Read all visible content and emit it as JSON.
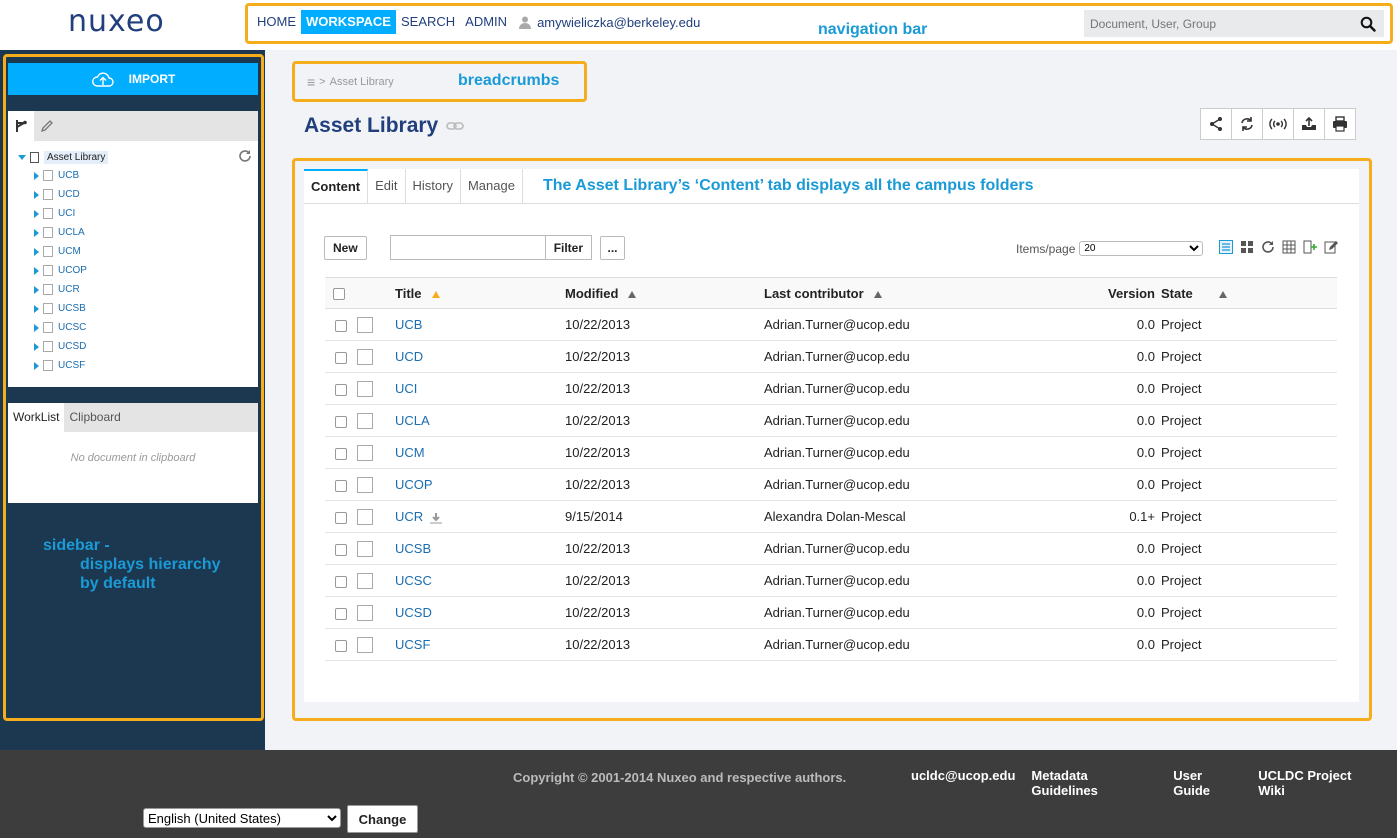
{
  "header": {
    "logo": "nuxeo",
    "nav": [
      "HOME",
      "WORKSPACE",
      "SEARCH",
      "ADMIN"
    ],
    "active_nav": "WORKSPACE",
    "user": "amywieliczka@berkeley.edu",
    "search_placeholder": "Document, User, Group"
  },
  "annotations": {
    "navigation_bar": "navigation bar",
    "breadcrumbs": "breadcrumbs",
    "content_tab": "The Asset Library’s ‘Content’ tab displays all the campus folders",
    "sidebar_1": "sidebar -",
    "sidebar_2": "displays hierarchy",
    "sidebar_3": "by default"
  },
  "sidebar": {
    "import_label": "IMPORT",
    "tree_root": "Asset Library",
    "tree_items": [
      "UCB",
      "UCD",
      "UCI",
      "UCLA",
      "UCM",
      "UCOP",
      "UCR",
      "UCSB",
      "UCSC",
      "UCSD",
      "UCSF"
    ],
    "clip_tabs": [
      "WorkList",
      "Clipboard"
    ],
    "clip_empty": "No document in clipboard"
  },
  "main": {
    "breadcrumb_icon": "≡",
    "breadcrumb_sep": ">",
    "breadcrumb": "Asset Library",
    "title": "Asset Library",
    "tabs": [
      "Content",
      "Edit",
      "History",
      "Manage"
    ],
    "new_label": "New",
    "filter_label": "Filter",
    "more_label": "...",
    "items_per_page_label": "Items/page",
    "items_per_page_value": "20",
    "columns": {
      "title": "Title",
      "modified": "Modified",
      "contributor": "Last contributor",
      "version": "Version",
      "state": "State"
    },
    "rows": [
      {
        "title": "UCB",
        "modified": "10/22/2013",
        "contributor": "Adrian.Turner@ucop.edu",
        "version": "0.0",
        "state": "Project"
      },
      {
        "title": "UCD",
        "modified": "10/22/2013",
        "contributor": "Adrian.Turner@ucop.edu",
        "version": "0.0",
        "state": "Project"
      },
      {
        "title": "UCI",
        "modified": "10/22/2013",
        "contributor": "Adrian.Turner@ucop.edu",
        "version": "0.0",
        "state": "Project"
      },
      {
        "title": "UCLA",
        "modified": "10/22/2013",
        "contributor": "Adrian.Turner@ucop.edu",
        "version": "0.0",
        "state": "Project"
      },
      {
        "title": "UCM",
        "modified": "10/22/2013",
        "contributor": "Adrian.Turner@ucop.edu",
        "version": "0.0",
        "state": "Project"
      },
      {
        "title": "UCOP",
        "modified": "10/22/2013",
        "contributor": "Adrian.Turner@ucop.edu",
        "version": "0.0",
        "state": "Project"
      },
      {
        "title": "UCR",
        "modified": "9/15/2014",
        "contributor": "Alexandra Dolan-Mescal",
        "version": "0.1+",
        "state": "Project"
      },
      {
        "title": "UCSB",
        "modified": "10/22/2013",
        "contributor": "Adrian.Turner@ucop.edu",
        "version": "0.0",
        "state": "Project"
      },
      {
        "title": "UCSC",
        "modified": "10/22/2013",
        "contributor": "Adrian.Turner@ucop.edu",
        "version": "0.0",
        "state": "Project"
      },
      {
        "title": "UCSD",
        "modified": "10/22/2013",
        "contributor": "Adrian.Turner@ucop.edu",
        "version": "0.0",
        "state": "Project"
      },
      {
        "title": "UCSF",
        "modified": "10/22/2013",
        "contributor": "Adrian.Turner@ucop.edu",
        "version": "0.0",
        "state": "Project"
      }
    ]
  },
  "footer": {
    "copyright": "Copyright © 2001-2014 Nuxeo and respective authors.",
    "links": [
      "ucldc@ucop.edu",
      "Metadata Guidelines",
      "User Guide",
      "UCLDC Project Wiki"
    ],
    "language": "English (United States)",
    "change_label": "Change"
  },
  "colors": {
    "accent": "#00adff",
    "brand": "#213f7d",
    "sidebar_bg": "#1b3850",
    "annotation_border": "#f5ad1b",
    "annotation_text": "#1a9ad6"
  }
}
